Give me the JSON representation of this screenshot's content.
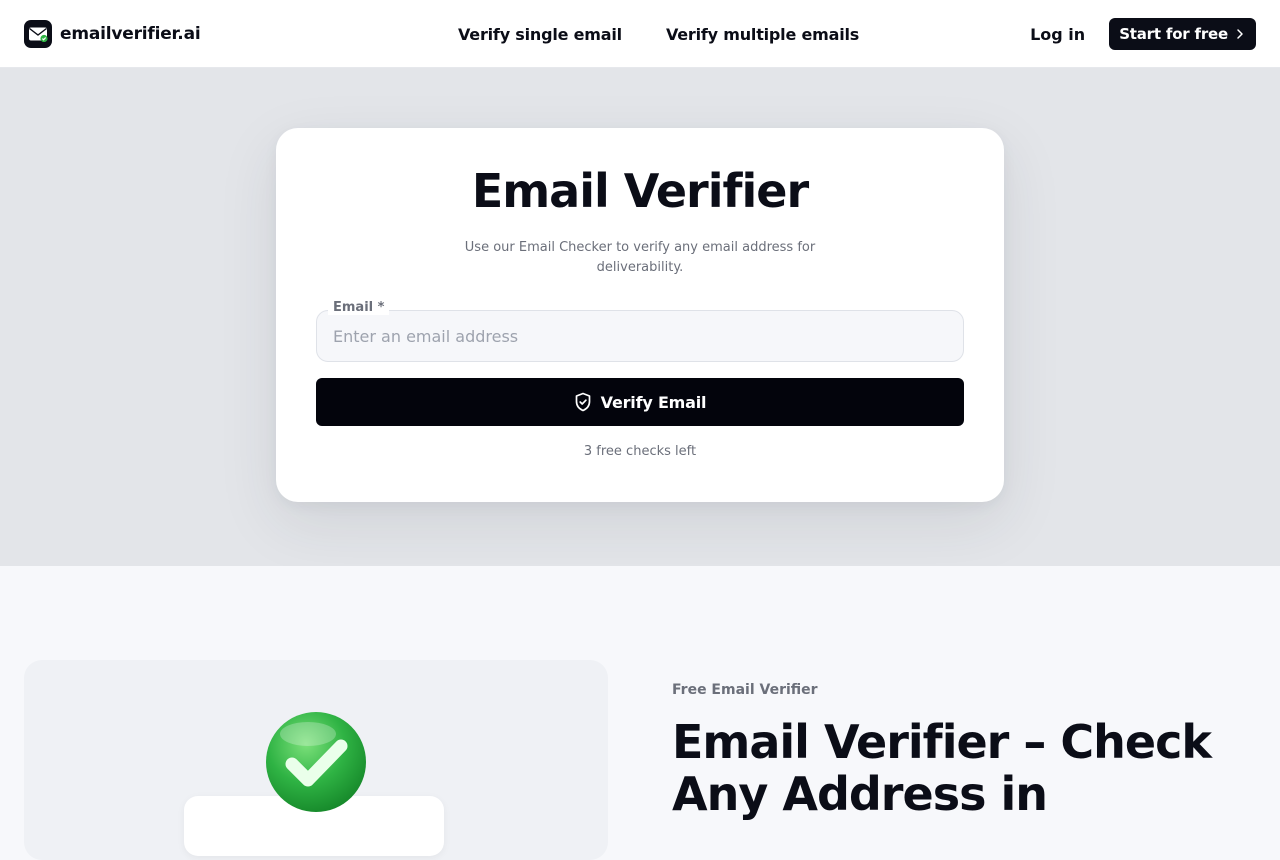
{
  "header": {
    "brand_name": "emailverifier.ai",
    "nav": [
      {
        "label": "Verify single email"
      },
      {
        "label": "Verify multiple emails"
      }
    ],
    "login_label": "Log in",
    "cta_label": "Start for free"
  },
  "hero": {
    "title": "Email Verifier",
    "subtitle": "Use our Email Checker to verify any email address for deliverability.",
    "email_label": "Email *",
    "email_placeholder": "Enter an email address",
    "email_value": "",
    "verify_button_label": "Verify Email",
    "checks_left": "3 free checks left"
  },
  "section": {
    "eyebrow": "Free Email Verifier",
    "title": "Email Verifier – Check Any Address in"
  },
  "icons": {
    "logo": "envelope-check-icon",
    "cta_arrow": "chevron-right-icon",
    "verify": "shield-check-icon",
    "illustration": "green-checkmark-icon"
  },
  "colors": {
    "primary": "#0b0d17",
    "button": "#03040c",
    "hero_bg": "#e3e5e9",
    "page_bg": "#f7f8fb",
    "muted_text": "#6b6f7a",
    "success_green": "#2fb344"
  }
}
